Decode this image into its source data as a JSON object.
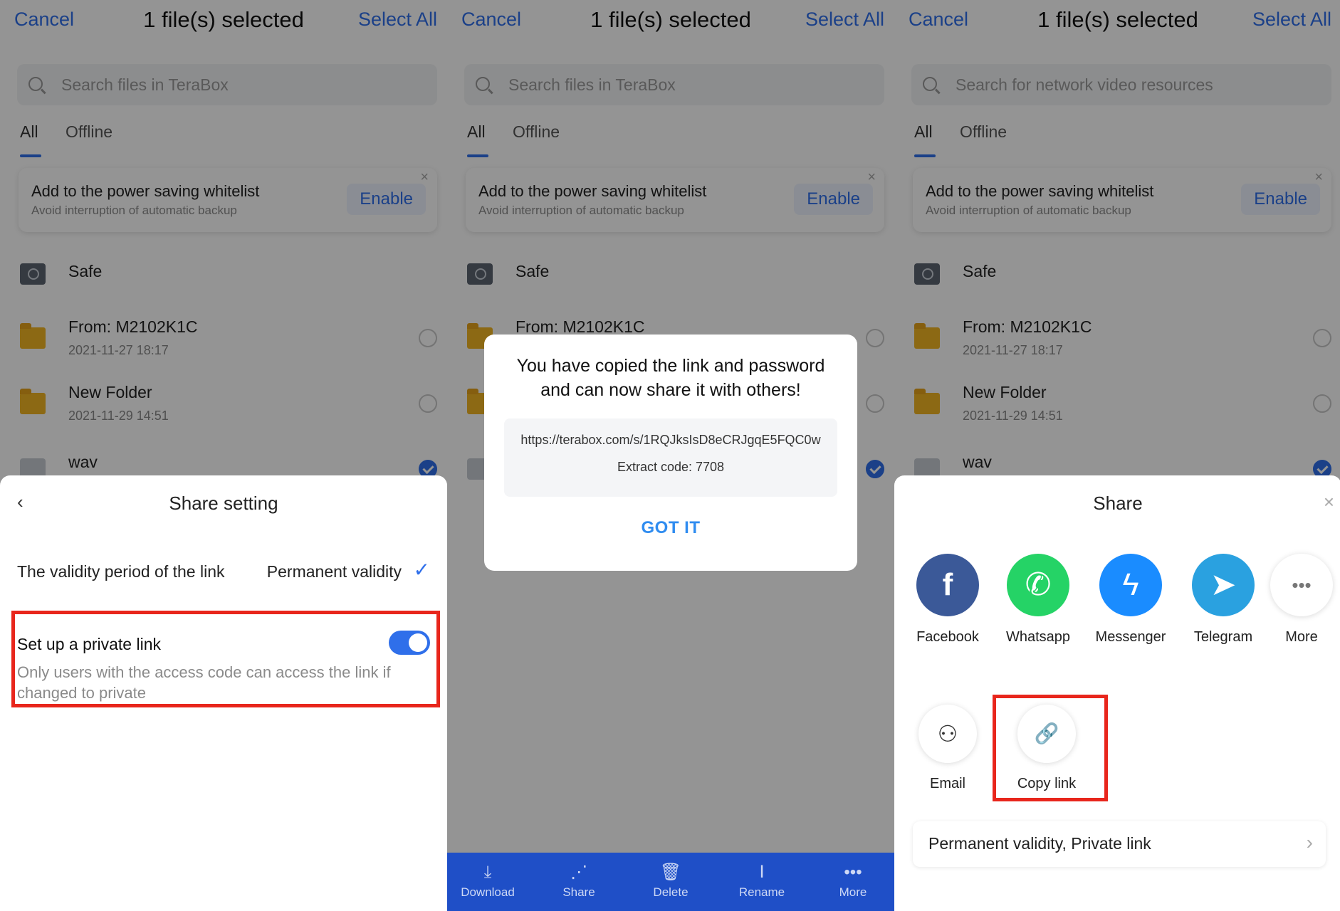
{
  "topbar": {
    "cancel": "Cancel",
    "title": "1 file(s) selected",
    "select_all": "Select All"
  },
  "search": {
    "placeholder_a": "Search files in TeraBox",
    "placeholder_b": "Search for network video resources"
  },
  "tabs": {
    "all": "All",
    "offline": "Offline"
  },
  "banner": {
    "title": "Add to the power saving whitelist",
    "subtitle": "Avoid interruption of automatic backup",
    "enable": "Enable",
    "close": "×"
  },
  "files": {
    "safe": "Safe",
    "folder1": {
      "name": "From: M2102K1C",
      "date": "2021-11-27  18:17"
    },
    "folder2": {
      "name": "New Folder",
      "date": "2021-11-29  14:51"
    },
    "wav": {
      "name": "wav"
    }
  },
  "share_setting": {
    "back": "‹",
    "title": "Share setting",
    "validity_label": "The validity period of the link",
    "validity_value": "Permanent validity",
    "private_title": "Set up a private link",
    "private_desc": "Only users with the access code can access the link if changed to private",
    "private_enabled": true
  },
  "dialog": {
    "line1": "You have copied the link and password",
    "line2": "and can now share it with others!",
    "url": "https://terabox.com/s/1RQJksIsD8eCRJgqE5FQC0w",
    "code": "Extract code: 7708",
    "button": "GOT IT"
  },
  "bottombar": [
    {
      "label": "Download",
      "icon": "download-icon",
      "glyph": "⤓"
    },
    {
      "label": "Share",
      "icon": "share-icon",
      "glyph": "⋰"
    },
    {
      "label": "Delete",
      "icon": "trash-icon",
      "glyph": "🗑"
    },
    {
      "label": "Rename",
      "icon": "rename-icon",
      "glyph": "Ⅰ"
    },
    {
      "label": "More",
      "icon": "more-icon",
      "glyph": "•••"
    }
  ],
  "share": {
    "title": "Share",
    "close": "×",
    "apps": [
      {
        "label": "Facebook",
        "icon": "facebook-icon",
        "color": "#3b5998",
        "glyph": "f"
      },
      {
        "label": "Whatsapp",
        "icon": "whatsapp-icon",
        "color": "#25d366",
        "glyph": "✆"
      },
      {
        "label": "Messenger",
        "icon": "messenger-icon",
        "color": "#1a8cff",
        "glyph": "ϟ"
      },
      {
        "label": "Telegram",
        "icon": "telegram-icon",
        "color": "#2aa1e0",
        "glyph": "➤"
      },
      {
        "label": "More",
        "icon": "more-icon",
        "color": "#ffffff",
        "glyph": "•••"
      }
    ],
    "actions": [
      {
        "label": "Email",
        "icon": "add-user-icon",
        "glyph": "⚇"
      },
      {
        "label": "Copy link",
        "icon": "link-icon",
        "glyph": "🔗"
      }
    ],
    "settings_row": "Permanent validity, Private link",
    "chevron": "›"
  },
  "colors": {
    "accent": "#2f6fea",
    "highlight": "#e8261c",
    "bottombar": "#1f4fc7"
  }
}
